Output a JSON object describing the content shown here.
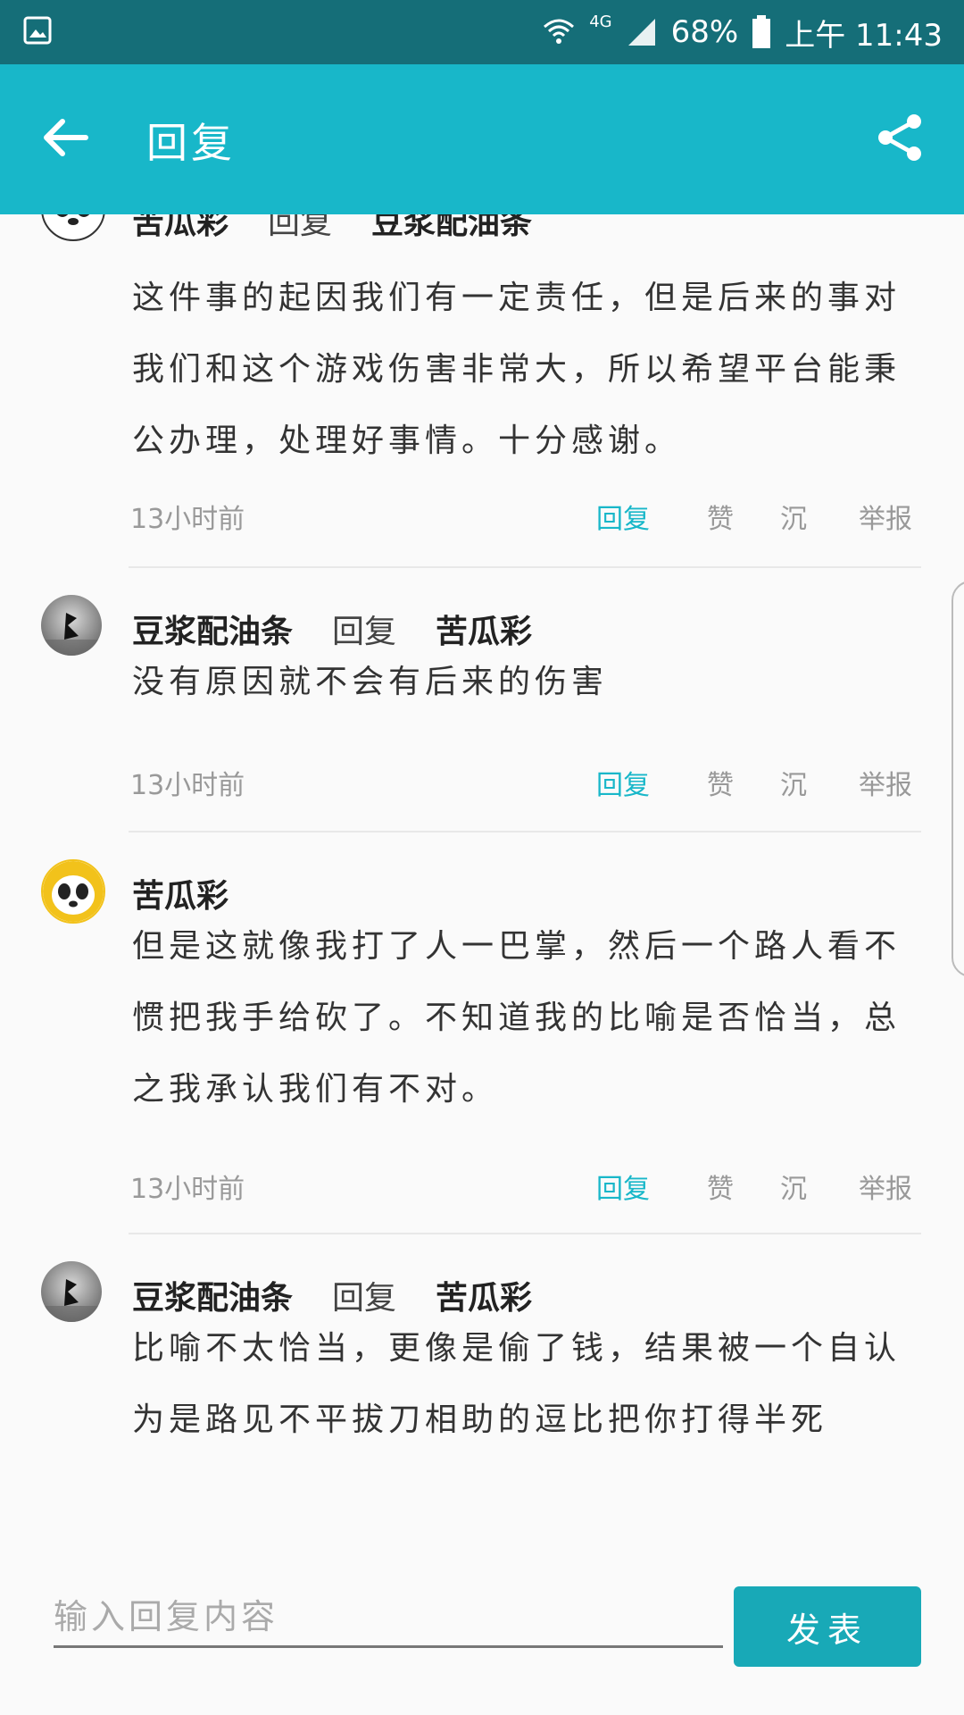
{
  "status_bar": {
    "network": "4G",
    "battery": "68%",
    "time": "上午 11:43"
  },
  "app_bar": {
    "title": "回复"
  },
  "comments": [
    {
      "author": "苦瓜彩",
      "reply_word": "回复",
      "reply_to": "豆浆配油条",
      "text": "这件事的起因我们有一定责任，但是后来的事对我们和这个游戏伤害非常大，所以希望平台能秉公办理，处理好事情。十分感谢。",
      "time": "13小时前"
    },
    {
      "author": "豆浆配油条",
      "reply_word": "回复",
      "reply_to": "苦瓜彩",
      "text": "没有原因就不会有后来的伤害",
      "time": "13小时前"
    },
    {
      "author": "苦瓜彩",
      "reply_word": "",
      "reply_to": "",
      "text": "但是这就像我打了人一巴掌，然后一个路人看不惯把我手给砍了。不知道我的比喻是否恰当，总之我承认我们有不对。",
      "time": "13小时前"
    },
    {
      "author": "豆浆配油条",
      "reply_word": "回复",
      "reply_to": "苦瓜彩",
      "text": "比喻不太恰当，更像是偷了钱，结果被一个自认为是路见不平拔刀相助的逗比把你打得半死",
      "time": ""
    }
  ],
  "actions": {
    "reply": "回复",
    "like": "赞",
    "sink": "沉",
    "report": "举报"
  },
  "input": {
    "placeholder": "输入回复内容",
    "value": ""
  },
  "send_label": "发表",
  "colors": {
    "status_bar": "#156e78",
    "app_bar": "#18b7c9",
    "accent": "#18b7c9",
    "send_button": "#18a9b7"
  },
  "icons": [
    "image-icon",
    "wifi-icon",
    "signal-icon",
    "battery-icon",
    "back-arrow-icon",
    "share-icon",
    "panda-avatar",
    "ink-avatar"
  ]
}
